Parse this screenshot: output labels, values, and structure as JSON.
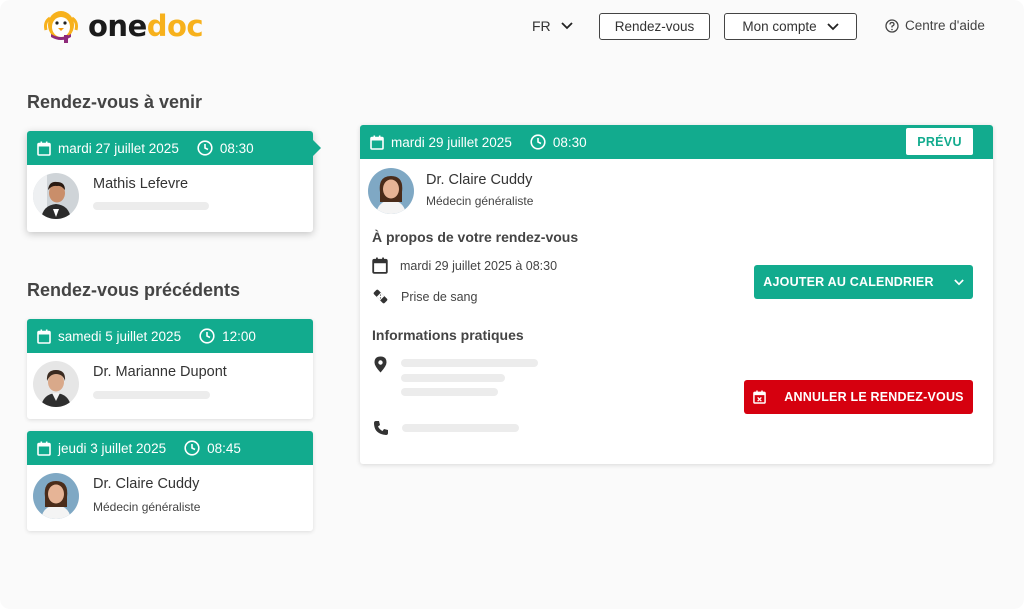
{
  "brand": {
    "one": "one",
    "doc": "doc"
  },
  "header": {
    "lang": "FR",
    "appointments_label": "Rendez-vous",
    "account_label": "Mon compte",
    "help_label": "Centre d'aide"
  },
  "upcoming": {
    "title": "Rendez-vous à venir",
    "items": [
      {
        "date": "mardi 27 juillet 2025",
        "time": "08:30",
        "name": "Mathis Lefevre"
      }
    ]
  },
  "past": {
    "title": "Rendez-vous précédents",
    "items": [
      {
        "date": "samedi 5 juillet 2025",
        "time": "12:00",
        "name": "Dr. Marianne Dupont"
      },
      {
        "date": "jeudi 3 juillet 2025",
        "time": "08:45",
        "name": "Dr. Claire Cuddy",
        "specialty": "Médecin généraliste"
      }
    ]
  },
  "detail": {
    "date": "mardi 29 juillet 2025",
    "time": "08:30",
    "status": "PRÉVU",
    "name": "Dr. Claire Cuddy",
    "specialty": "Médecin généraliste",
    "about_title": "À propos de votre rendez-vous",
    "datetime": "mardi 29 juillet 2025 à 08:30",
    "reason": "Prise de sang",
    "add_calendar_label": "AJOUTER AU CALENDRIER",
    "practical_title": "Informations pratiques",
    "cancel_label": "ANNULER LE RENDEZ-VOUS"
  },
  "colors": {
    "accent": "#12ab8e",
    "danger": "#d6000f",
    "brand_yellow": "#f7b11c"
  }
}
